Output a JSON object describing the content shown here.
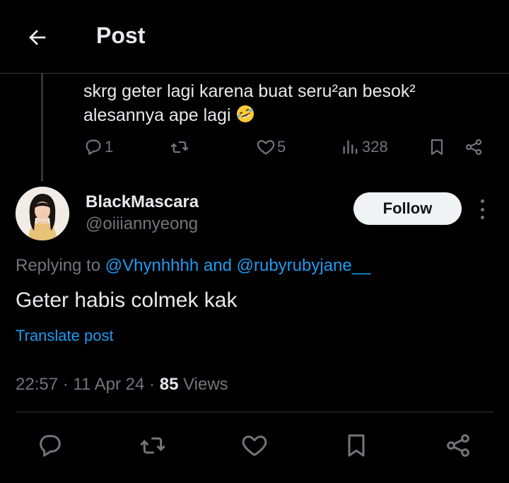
{
  "header": {
    "title": "Post"
  },
  "previous_post": {
    "line1": "skrg geter lagi karena buat seru²an besok²",
    "line2": "alesannya ape lagi",
    "emoji": "rolling-on-floor-laughing-emoji",
    "replies": "1",
    "likes": "5",
    "views": "328"
  },
  "post": {
    "display_name": "BlackMascara",
    "handle": "@oiiiannyeong",
    "follow_label": "Follow",
    "replying_prefix": "Replying to",
    "mention_1": "@Vhynhhhh",
    "replying_and": "and",
    "mention_2": "@rubyrubyjane__",
    "text": "Geter habis colmek kak",
    "translate_label": "Translate post",
    "time": "22:57",
    "date": "11 Apr 24",
    "views_count": "85",
    "views_label": "Views"
  },
  "icons": {
    "back": "arrow-left-icon",
    "reply": "reply-bubble-icon",
    "repost": "repost-icon",
    "like": "heart-icon",
    "views": "bar-chart-icon",
    "bookmark": "bookmark-icon",
    "share": "share-icon",
    "more": "more-vertical-icon"
  },
  "colors": {
    "background": "#000000",
    "text": "#e7e9ea",
    "muted": "#71767b",
    "accent": "#1d9bf0",
    "divider": "#2f3336"
  }
}
